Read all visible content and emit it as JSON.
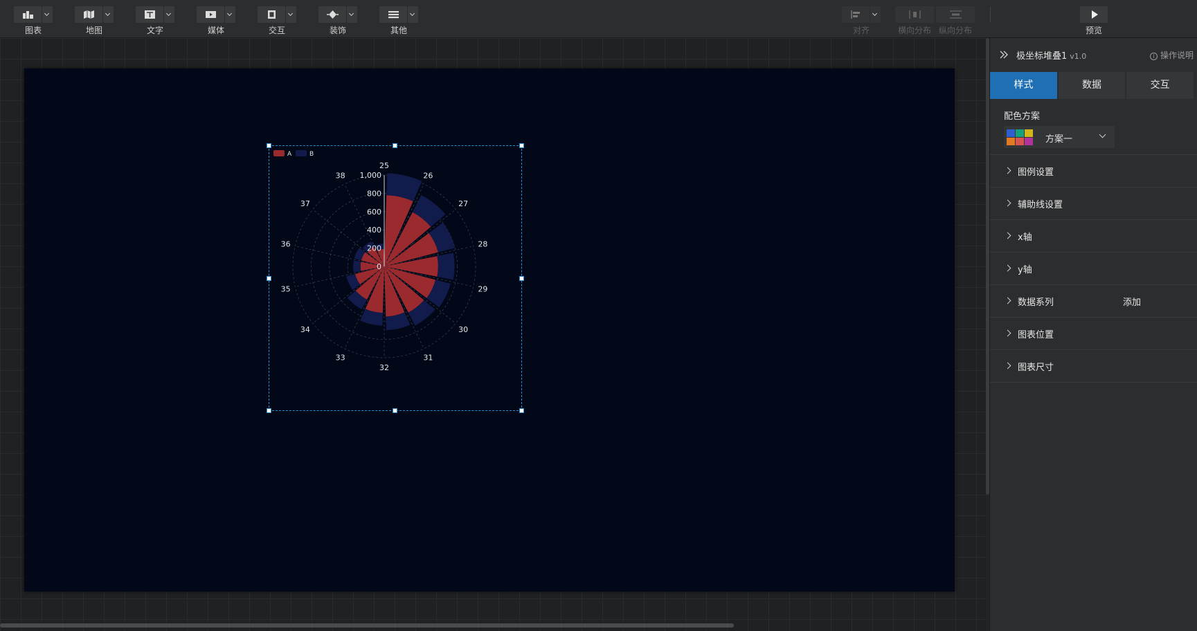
{
  "toolbar": {
    "tools": [
      {
        "label": "图表",
        "icon": "chart-icon"
      },
      {
        "label": "地图",
        "icon": "map-icon"
      },
      {
        "label": "文字",
        "icon": "text-icon"
      },
      {
        "label": "媒体",
        "icon": "media-icon"
      },
      {
        "label": "交互",
        "icon": "interaction-icon"
      },
      {
        "label": "装饰",
        "icon": "decoration-icon"
      },
      {
        "label": "其他",
        "icon": "other-icon"
      }
    ],
    "align_label": "对齐",
    "h_distribute_label": "横向分布",
    "v_distribute_label": "纵向分布",
    "preview_label": "预览"
  },
  "panel": {
    "title": "极坐标堆叠1",
    "version": "v1.0",
    "help": "操作说明",
    "tabs": [
      {
        "label": "样式",
        "active": true
      },
      {
        "label": "数据",
        "active": false
      },
      {
        "label": "交互",
        "active": false
      }
    ],
    "color_scheme_label": "配色方案",
    "color_scheme_value": "方案一",
    "swatch_colors": [
      "#2f5fcf",
      "#14a27c",
      "#d2b61b",
      "#e07b24",
      "#d9534f",
      "#b0339a"
    ],
    "sections": [
      {
        "name": "图例设置",
        "extra": ""
      },
      {
        "name": "辅助线设置",
        "extra": ""
      },
      {
        "name": "x轴",
        "extra": ""
      },
      {
        "name": "y轴",
        "extra": ""
      },
      {
        "name": "数据系列",
        "extra": "添加"
      },
      {
        "name": "图表位置",
        "extra": ""
      },
      {
        "name": "图表尺寸",
        "extra": ""
      }
    ]
  },
  "colors": {
    "series_a": "#9b2a2e",
    "series_b": "#111b4c",
    "stage_bg": "#020817",
    "accent": "#1f6fb5"
  },
  "chart_data": {
    "type": "bar",
    "polar": true,
    "categories": [
      "25",
      "26",
      "27",
      "28",
      "29",
      "30",
      "31",
      "32",
      "33",
      "34",
      "35",
      "36",
      "37",
      "38"
    ],
    "radial_ticks": [
      "0",
      "200",
      "400",
      "600",
      "800",
      "1,000"
    ],
    "rlim": [
      0,
      1000
    ],
    "legend": [
      "A",
      "B"
    ],
    "legend_position": "top-left",
    "series": [
      {
        "name": "A",
        "values": [
          780,
          670,
          610,
          590,
          580,
          570,
          550,
          510,
          410,
          330,
          260,
          260,
          240,
          190
        ]
      },
      {
        "name": "B",
        "values": [
          240,
          210,
          190,
          180,
          170,
          160,
          150,
          140,
          120,
          100,
          80,
          80,
          70,
          60
        ]
      }
    ]
  }
}
